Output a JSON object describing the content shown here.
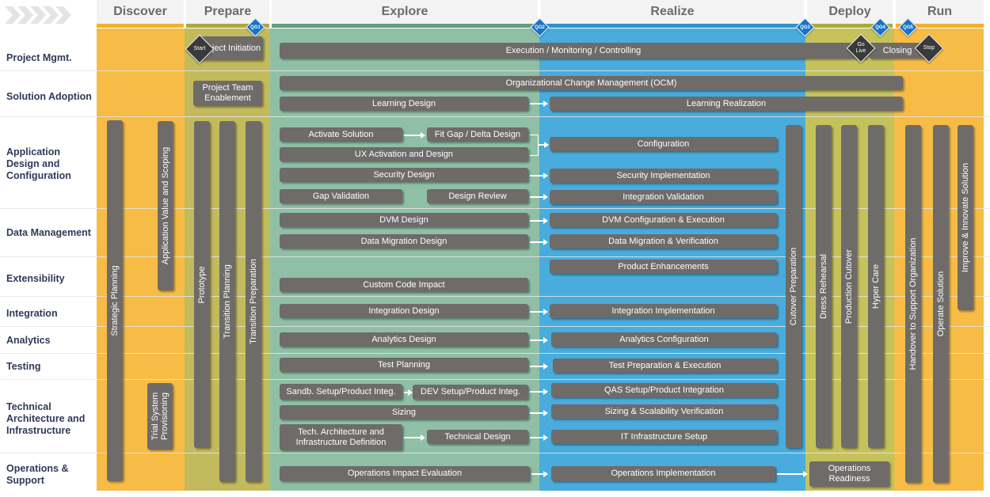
{
  "colors": {
    "discover": "#f6bc45",
    "prepare": "#c3ba5e",
    "explore": "#8fc0a6",
    "realize": "#49acdc",
    "deploy": "#c5c25c",
    "run": "#f6bc45",
    "bar": "#6e6b69",
    "qg": "#1a73c4"
  },
  "phases": {
    "discover": "Discover",
    "prepare": "Prepare",
    "explore": "Explore",
    "realize": "Realize",
    "deploy": "Deploy",
    "run": "Run"
  },
  "quality_gates": {
    "qg1": "QG1",
    "qg2": "QG2",
    "qg3": "QG3",
    "qg4": "QG4",
    "qg5": "QG5"
  },
  "milestones": {
    "start": "Start",
    "go_live": "Go\nLive",
    "stop": "Stop"
  },
  "rows": {
    "project_mgmt": "Project Mgmt.",
    "solution_adoption": "Solution Adoption",
    "app_design": "Application Design and Configuration",
    "data_mgmt": "Data Management",
    "extensibility": "Extensibility",
    "integration": "Integration",
    "analytics": "Analytics",
    "testing": "Testing",
    "tech_arch": "Technical Architecture and Infrastructure",
    "operations": "Operations & Support"
  },
  "activities": {
    "project_initiation": "Project Initiation",
    "execution": "Execution / Monitoring / Controlling",
    "closing": "Closing",
    "team_enablement": "Project Team Enablement",
    "ocm": "Organizational Change Management (OCM)",
    "learning_design": "Learning Design",
    "learning_realization": "Learning Realization",
    "activate_solution": "Activate Solution",
    "fit_gap": "Fit Gap / Delta Design",
    "ux_activation": "UX Activation and Design",
    "configuration": "Configuration",
    "security_design": "Security Design",
    "security_impl": "Security Implementation",
    "gap_validation": "Gap Validation",
    "design_review": "Design Review",
    "integration_validation": "Integration Validation",
    "dvm_design": "DVM Design",
    "dvm_config": "DVM Configuration & Execution",
    "data_migration_design": "Data Migration Design",
    "data_migration_verif": "Data Migration & Verification",
    "product_enhancements": "Product Enhancements",
    "custom_code": "Custom Code Impact",
    "integration_design": "Integration Design",
    "integration_impl": "Integration Implementation",
    "analytics_design": "Analytics Design",
    "analytics_config": "Analytics Configuration",
    "test_planning": "Test Planning",
    "test_prep": "Test Preparation & Execution",
    "sandbox_setup": "Sandb. Setup/Product Integ.",
    "dev_setup": "DEV Setup/Product Integ.",
    "qas_setup": "QAS Setup/Product Integration",
    "sizing": "Sizing",
    "sizing_verif": "Sizing & Scalability Verification",
    "tech_arch_def": "Tech. Architecture and Infrastructure Definition",
    "technical_design": "Technical Design",
    "it_infra": "IT Infrastructure Setup",
    "ops_impact": "Operations Impact Evaluation",
    "ops_impl": "Operations Implementation",
    "ops_readiness": "Operations Readiness"
  },
  "vertical_activities": {
    "strategic_planning": "Strategic Planning",
    "app_value_scoping": "Application Value and Scoping",
    "trial_system": "Trial System Provisioning",
    "prototype": "Prototype",
    "transition_planning": "Transition Planning",
    "transition_preparation": "Transition Preparation",
    "cutover_preparation": "Cutover Preparation",
    "dress_rehearsal": "Dress Rehearsal",
    "production_cutover": "Production Cutover",
    "hyper_care": "Hyper Care",
    "handover": "Handover to Support Organization",
    "operate_solution": "Operate Solution",
    "improve_innovate": "Improve & Innovate Solution"
  }
}
